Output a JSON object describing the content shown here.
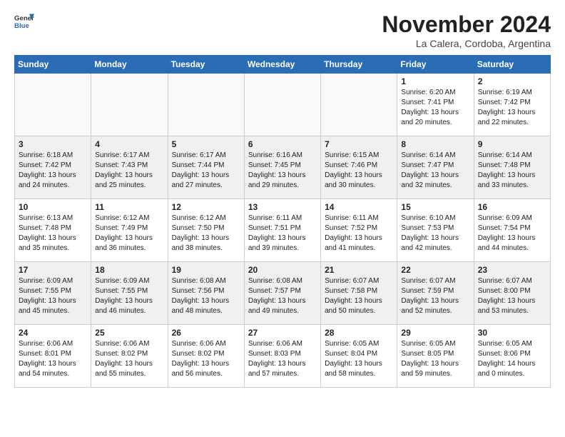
{
  "header": {
    "logo_general": "General",
    "logo_blue": "Blue",
    "month_title": "November 2024",
    "location": "La Calera, Cordoba, Argentina"
  },
  "days_of_week": [
    "Sunday",
    "Monday",
    "Tuesday",
    "Wednesday",
    "Thursday",
    "Friday",
    "Saturday"
  ],
  "weeks": [
    [
      {
        "day": "",
        "info": ""
      },
      {
        "day": "",
        "info": ""
      },
      {
        "day": "",
        "info": ""
      },
      {
        "day": "",
        "info": ""
      },
      {
        "day": "",
        "info": ""
      },
      {
        "day": "1",
        "info": "Sunrise: 6:20 AM\nSunset: 7:41 PM\nDaylight: 13 hours\nand 20 minutes."
      },
      {
        "day": "2",
        "info": "Sunrise: 6:19 AM\nSunset: 7:42 PM\nDaylight: 13 hours\nand 22 minutes."
      }
    ],
    [
      {
        "day": "3",
        "info": "Sunrise: 6:18 AM\nSunset: 7:42 PM\nDaylight: 13 hours\nand 24 minutes."
      },
      {
        "day": "4",
        "info": "Sunrise: 6:17 AM\nSunset: 7:43 PM\nDaylight: 13 hours\nand 25 minutes."
      },
      {
        "day": "5",
        "info": "Sunrise: 6:17 AM\nSunset: 7:44 PM\nDaylight: 13 hours\nand 27 minutes."
      },
      {
        "day": "6",
        "info": "Sunrise: 6:16 AM\nSunset: 7:45 PM\nDaylight: 13 hours\nand 29 minutes."
      },
      {
        "day": "7",
        "info": "Sunrise: 6:15 AM\nSunset: 7:46 PM\nDaylight: 13 hours\nand 30 minutes."
      },
      {
        "day": "8",
        "info": "Sunrise: 6:14 AM\nSunset: 7:47 PM\nDaylight: 13 hours\nand 32 minutes."
      },
      {
        "day": "9",
        "info": "Sunrise: 6:14 AM\nSunset: 7:48 PM\nDaylight: 13 hours\nand 33 minutes."
      }
    ],
    [
      {
        "day": "10",
        "info": "Sunrise: 6:13 AM\nSunset: 7:48 PM\nDaylight: 13 hours\nand 35 minutes."
      },
      {
        "day": "11",
        "info": "Sunrise: 6:12 AM\nSunset: 7:49 PM\nDaylight: 13 hours\nand 36 minutes."
      },
      {
        "day": "12",
        "info": "Sunrise: 6:12 AM\nSunset: 7:50 PM\nDaylight: 13 hours\nand 38 minutes."
      },
      {
        "day": "13",
        "info": "Sunrise: 6:11 AM\nSunset: 7:51 PM\nDaylight: 13 hours\nand 39 minutes."
      },
      {
        "day": "14",
        "info": "Sunrise: 6:11 AM\nSunset: 7:52 PM\nDaylight: 13 hours\nand 41 minutes."
      },
      {
        "day": "15",
        "info": "Sunrise: 6:10 AM\nSunset: 7:53 PM\nDaylight: 13 hours\nand 42 minutes."
      },
      {
        "day": "16",
        "info": "Sunrise: 6:09 AM\nSunset: 7:54 PM\nDaylight: 13 hours\nand 44 minutes."
      }
    ],
    [
      {
        "day": "17",
        "info": "Sunrise: 6:09 AM\nSunset: 7:55 PM\nDaylight: 13 hours\nand 45 minutes."
      },
      {
        "day": "18",
        "info": "Sunrise: 6:09 AM\nSunset: 7:55 PM\nDaylight: 13 hours\nand 46 minutes."
      },
      {
        "day": "19",
        "info": "Sunrise: 6:08 AM\nSunset: 7:56 PM\nDaylight: 13 hours\nand 48 minutes."
      },
      {
        "day": "20",
        "info": "Sunrise: 6:08 AM\nSunset: 7:57 PM\nDaylight: 13 hours\nand 49 minutes."
      },
      {
        "day": "21",
        "info": "Sunrise: 6:07 AM\nSunset: 7:58 PM\nDaylight: 13 hours\nand 50 minutes."
      },
      {
        "day": "22",
        "info": "Sunrise: 6:07 AM\nSunset: 7:59 PM\nDaylight: 13 hours\nand 52 minutes."
      },
      {
        "day": "23",
        "info": "Sunrise: 6:07 AM\nSunset: 8:00 PM\nDaylight: 13 hours\nand 53 minutes."
      }
    ],
    [
      {
        "day": "24",
        "info": "Sunrise: 6:06 AM\nSunset: 8:01 PM\nDaylight: 13 hours\nand 54 minutes."
      },
      {
        "day": "25",
        "info": "Sunrise: 6:06 AM\nSunset: 8:02 PM\nDaylight: 13 hours\nand 55 minutes."
      },
      {
        "day": "26",
        "info": "Sunrise: 6:06 AM\nSunset: 8:02 PM\nDaylight: 13 hours\nand 56 minutes."
      },
      {
        "day": "27",
        "info": "Sunrise: 6:06 AM\nSunset: 8:03 PM\nDaylight: 13 hours\nand 57 minutes."
      },
      {
        "day": "28",
        "info": "Sunrise: 6:05 AM\nSunset: 8:04 PM\nDaylight: 13 hours\nand 58 minutes."
      },
      {
        "day": "29",
        "info": "Sunrise: 6:05 AM\nSunset: 8:05 PM\nDaylight: 13 hours\nand 59 minutes."
      },
      {
        "day": "30",
        "info": "Sunrise: 6:05 AM\nSunset: 8:06 PM\nDaylight: 14 hours\nand 0 minutes."
      }
    ]
  ]
}
